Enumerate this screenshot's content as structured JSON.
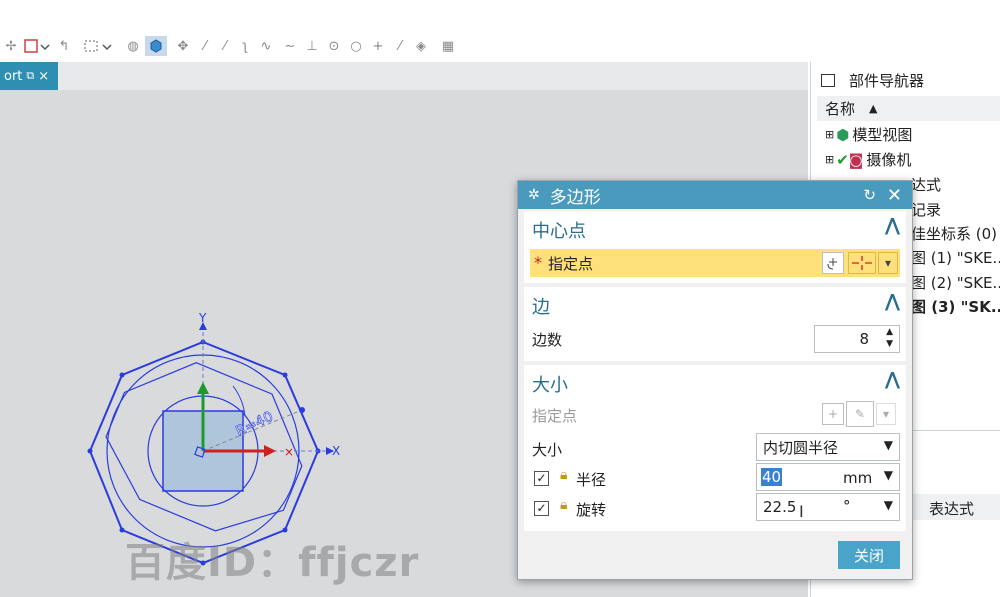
{
  "viewport": {
    "tab_label": "ort",
    "tab_close": "×"
  },
  "navigator": {
    "title": "部件导航器",
    "column_name": "名称",
    "sort_arrow": "▲",
    "items": [
      {
        "label": "模型视图"
      },
      {
        "label": "摄像机"
      },
      {
        "label": "达式"
      },
      {
        "label": "记录"
      },
      {
        "label": "佳坐标系 (0)"
      },
      {
        "label": "图 (1) \"SKE..."
      },
      {
        "label": "图 (2) \"SKE..."
      },
      {
        "label": "图 (3) \"SK..."
      }
    ],
    "lower_column": "表达式"
  },
  "dialog": {
    "title": "多边形",
    "center": {
      "heading": "中心点",
      "specify_point": "指定点",
      "required_mark": "*"
    },
    "edges": {
      "heading": "边",
      "count_label": "边数",
      "count_value": "8"
    },
    "size": {
      "heading": "大小",
      "specify_point": "指定点",
      "size_label": "大小",
      "size_mode": "内切圆半径",
      "radius_label": "半径",
      "radius_value": "40",
      "radius_unit": "mm",
      "rotation_label": "旋转",
      "rotation_value": "22.5",
      "rotation_unit": "°"
    },
    "close_label": "关闭"
  },
  "sketch": {
    "axis_y": "Y",
    "axis_x": "X",
    "dim_text": "R=40"
  },
  "watermark": "百度ID：ffjczr",
  "colors": {
    "dialog_title": "#4a9abd",
    "section_head": "#2a6d8f",
    "highlight": "#ffe07a",
    "sketch_line": "#2a3be0",
    "accent_button": "#4aa3c8"
  }
}
